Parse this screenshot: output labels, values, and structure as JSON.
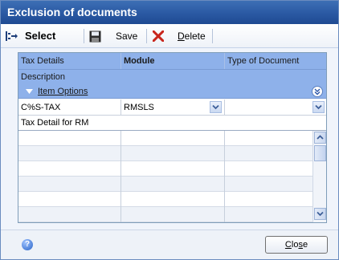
{
  "window": {
    "title": "Exclusion of documents"
  },
  "toolbar": {
    "select_label": "Select",
    "save_label": "Save",
    "delete_label": "Delete"
  },
  "grid": {
    "headers": {
      "tax_details": "Tax Details",
      "module": "Module",
      "type_of_document": "Type of Document"
    },
    "description_header": "Description",
    "item_options_label": "Item Options",
    "selected_row": {
      "tax_details": "C%S-TAX",
      "module": "RMSLS",
      "type_of_document": ""
    },
    "description_value": "Tax Detail for RM"
  },
  "footer": {
    "close_label": "Close"
  }
}
